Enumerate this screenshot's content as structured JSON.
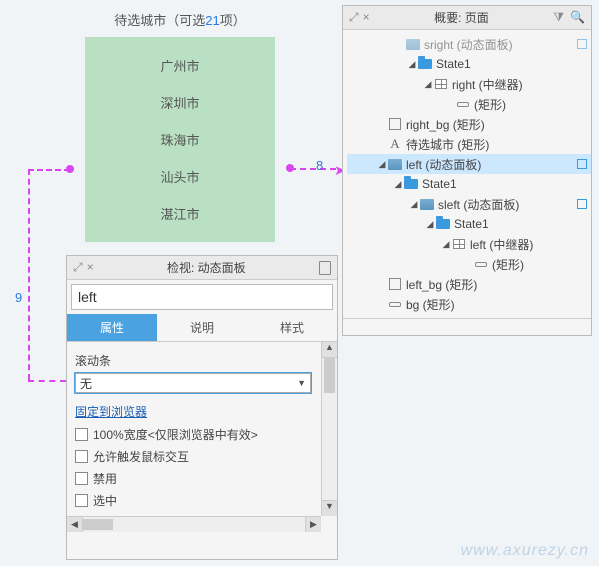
{
  "canvas": {
    "title_prefix": "待选城市（可选",
    "title_count": "21",
    "title_suffix": "项）",
    "cities": [
      "广州市",
      "深圳市",
      "珠海市",
      "汕头市",
      "湛江市"
    ]
  },
  "annotations": {
    "a8": "8",
    "a9": "9"
  },
  "outline": {
    "title": "概要: 页面",
    "rows": [
      {
        "ind": 48,
        "tri": "",
        "ic": "dp",
        "txt": "sright (动态面板)",
        "sel": false,
        "sq": true,
        "dim": true
      },
      {
        "ind": 60,
        "tri": "◢",
        "ic": "folder",
        "txt": "State1",
        "sel": false,
        "sq": false
      },
      {
        "ind": 76,
        "tri": "◢",
        "ic": "grid",
        "txt": "right (中继器)",
        "sel": false,
        "sq": false
      },
      {
        "ind": 98,
        "tri": "",
        "ic": "rect",
        "txt": "(矩形)",
        "sel": false,
        "sq": false
      },
      {
        "ind": 30,
        "tri": "",
        "ic": "check",
        "txt": "right_bg (矩形)",
        "sel": false,
        "sq": false
      },
      {
        "ind": 30,
        "tri": "",
        "ic": "A",
        "txt": "待选城市 (矩形)",
        "sel": false,
        "sq": false
      },
      {
        "ind": 30,
        "tri": "◢",
        "ic": "dp",
        "txt": "left (动态面板)",
        "sel": true,
        "sq": true
      },
      {
        "ind": 46,
        "tri": "◢",
        "ic": "folder",
        "txt": "State1",
        "sel": false,
        "sq": false
      },
      {
        "ind": 62,
        "tri": "◢",
        "ic": "dp",
        "txt": "sleft (动态面板)",
        "sel": false,
        "sq": true
      },
      {
        "ind": 78,
        "tri": "◢",
        "ic": "folder",
        "txt": "State1",
        "sel": false,
        "sq": false
      },
      {
        "ind": 94,
        "tri": "◢",
        "ic": "grid",
        "txt": "left (中继器)",
        "sel": false,
        "sq": false
      },
      {
        "ind": 116,
        "tri": "",
        "ic": "rect",
        "txt": "(矩形)",
        "sel": false,
        "sq": false
      },
      {
        "ind": 30,
        "tri": "",
        "ic": "check",
        "txt": "left_bg (矩形)",
        "sel": false,
        "sq": false
      },
      {
        "ind": 30,
        "tri": "",
        "ic": "rect",
        "txt": "bg (矩形)",
        "sel": false,
        "sq": false
      }
    ]
  },
  "inspector": {
    "title": "检视: 动态面板",
    "name_value": "left",
    "tabs": [
      "属性",
      "说明",
      "样式"
    ],
    "active_tab": 0,
    "scroll_label": "滚动条",
    "scroll_value": "无",
    "fix_link": "固定到浏览器",
    "checkboxes": [
      "100%宽度<仅限浏览器中有效>",
      "允许触发鼠标交互",
      "禁用",
      "选中"
    ]
  },
  "watermark": "www.axurezy.cn"
}
